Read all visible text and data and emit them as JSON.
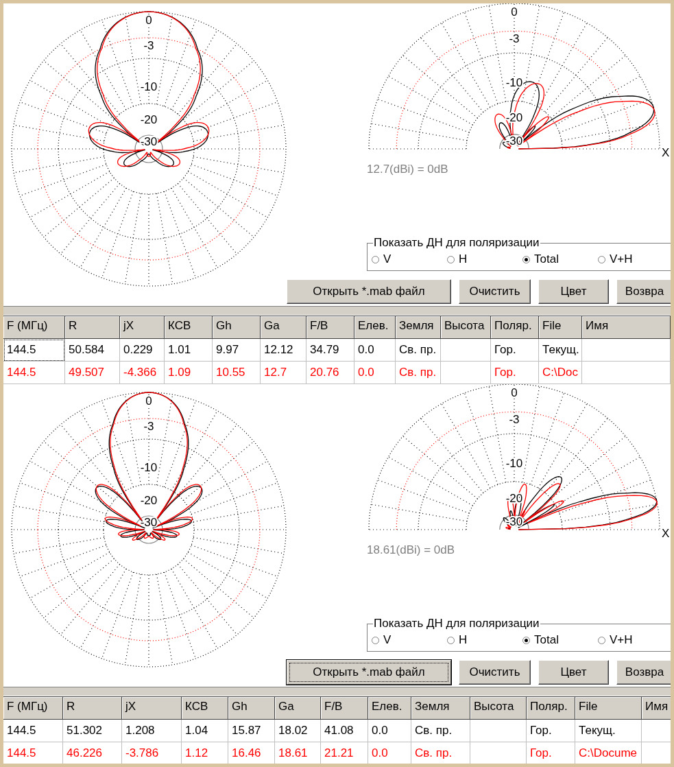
{
  "panels": [
    {
      "azimuth_plot": {
        "labels": [
          "0",
          "-3",
          "-10",
          "-20",
          "-30"
        ]
      },
      "elevation_plot": {
        "labels": [
          "0",
          "-3",
          "-10",
          "-20",
          "-30"
        ],
        "axis_label": "X",
        "gain_note": "12.7(dBi) = 0dB"
      },
      "polarization": {
        "title": "Показать ДН для поляризации",
        "options": [
          {
            "label": "V",
            "selected": false
          },
          {
            "label": "H",
            "selected": false
          },
          {
            "label": "Total",
            "selected": true
          },
          {
            "label": "V+H",
            "selected": false
          }
        ]
      },
      "buttons": [
        {
          "label": "Открыть *.mab файл",
          "focused": false
        },
        {
          "label": "Очистить",
          "focused": false
        },
        {
          "label": "Цвет",
          "focused": false
        },
        {
          "label": "Возвра",
          "focused": false
        }
      ],
      "table": {
        "columns": [
          "F (МГц)",
          "R",
          "jX",
          "КСВ",
          "Gh",
          "Ga",
          "F/B",
          "Елев.",
          "Земля",
          "Высота",
          "Поляр.",
          "File",
          "Имя"
        ],
        "rows": [
          {
            "color": "#000000",
            "focused": true,
            "cells": [
              "144.5",
              "50.584",
              "0.229",
              "1.01",
              "9.97",
              "12.12",
              "34.79",
              "0.0",
              "Св. пр.",
              null,
              "Гор.",
              "Текущ.",
              null
            ]
          },
          {
            "color": "#ff0000",
            "focused": false,
            "cells": [
              "144.5",
              "49.507",
              "-4.366",
              "1.09",
              "10.55",
              "12.7",
              "20.76",
              "0.0",
              "Св. пр.",
              null,
              "Гор.",
              "C:\\Doc",
              null
            ]
          }
        ]
      }
    },
    {
      "azimuth_plot": {
        "labels": [
          "0",
          "-3",
          "-10",
          "-20",
          "-30"
        ]
      },
      "elevation_plot": {
        "labels": [
          "0",
          "-3",
          "-10",
          "-20",
          "-30"
        ],
        "axis_label": "X",
        "gain_note": "18.61(dBi) = 0dB"
      },
      "polarization": {
        "title": "Показать ДН для поляризации",
        "options": [
          {
            "label": "V",
            "selected": false
          },
          {
            "label": "H",
            "selected": false
          },
          {
            "label": "Total",
            "selected": true
          },
          {
            "label": "V+H",
            "selected": false
          }
        ]
      },
      "buttons": [
        {
          "label": "Открыть *.mab файл",
          "focused": true
        },
        {
          "label": "Очистить",
          "focused": false
        },
        {
          "label": "Цвет",
          "focused": false
        },
        {
          "label": "Возвра",
          "focused": false
        }
      ],
      "table": {
        "columns": [
          "F (МГц)",
          "R",
          "jX",
          "КСВ",
          "Gh",
          "Ga",
          "F/B",
          "Елев.",
          "Земля",
          "Высота",
          "Поляр.",
          "File",
          "Имя"
        ],
        "rows": [
          {
            "color": "#000000",
            "focused": false,
            "cells": [
              "144.5",
              "51.302",
              "1.208",
              "1.04",
              "15.87",
              "18.02",
              "41.08",
              "0.0",
              "Св. пр.",
              null,
              "Гор.",
              "Текущ.",
              null
            ]
          },
          {
            "color": "#ff0000",
            "focused": false,
            "cells": [
              "144.5",
              "46.226",
              "-3.786",
              "1.12",
              "16.46",
              "18.61",
              "21.21",
              "0.0",
              "Св. пр.",
              null,
              "Гор.",
              "C:\\Docume",
              null
            ]
          }
        ]
      }
    }
  ]
}
